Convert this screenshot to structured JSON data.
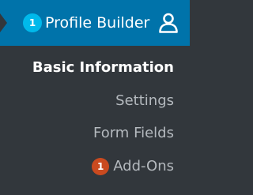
{
  "menu": {
    "title": "Profile Builder",
    "notification_count": "1",
    "icon": "user-icon",
    "items": [
      {
        "label": "Basic Information",
        "current": true
      },
      {
        "label": "Settings",
        "current": false
      },
      {
        "label": "Form Fields",
        "current": false
      },
      {
        "label": "Add-Ons",
        "current": false,
        "badge": "1"
      }
    ]
  },
  "colors": {
    "header_bg": "#0073aa",
    "sidebar_bg": "#32373c",
    "notification_badge": "#00b9eb",
    "addons_badge": "#ca4a1f",
    "current_item_text": "#ffffff",
    "item_text": "#b4b9be"
  }
}
